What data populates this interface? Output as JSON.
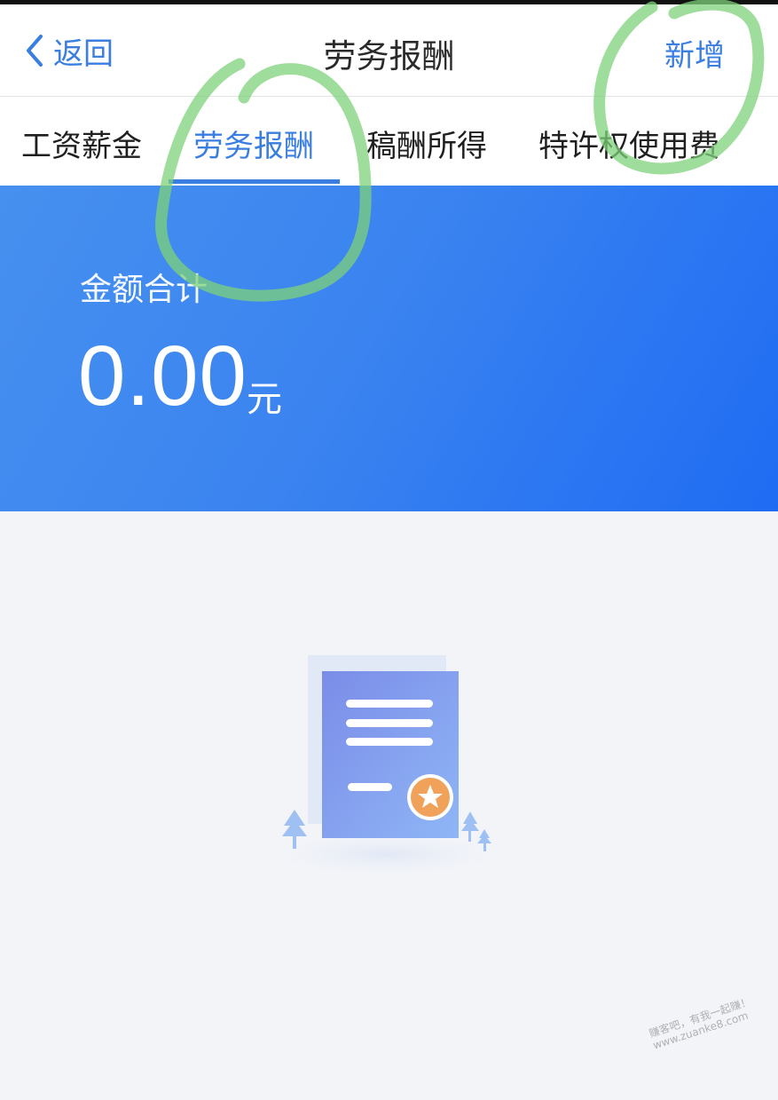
{
  "nav": {
    "back_label": "返回",
    "title": "劳务报酬",
    "add_label": "新增"
  },
  "tabs": [
    {
      "label": "工资薪金",
      "active": false
    },
    {
      "label": "劳务报酬",
      "active": true
    },
    {
      "label": "稿酬所得",
      "active": false
    },
    {
      "label": "特许权使用费",
      "active": false
    }
  ],
  "summary": {
    "label": "金额合计",
    "amount": "0.00",
    "unit": "元"
  },
  "empty_state": {
    "icon": "document-certificate-icon"
  },
  "watermark": {
    "line1": "赚客吧，有我一起赚！",
    "line2": "www.zuanke8.com"
  },
  "colors": {
    "accent": "#3a7ee0",
    "banner_start": "#4690ef",
    "banner_end": "#1f6cf3",
    "page_bg": "#f2f4f8",
    "annotation": "#7ed27a"
  }
}
